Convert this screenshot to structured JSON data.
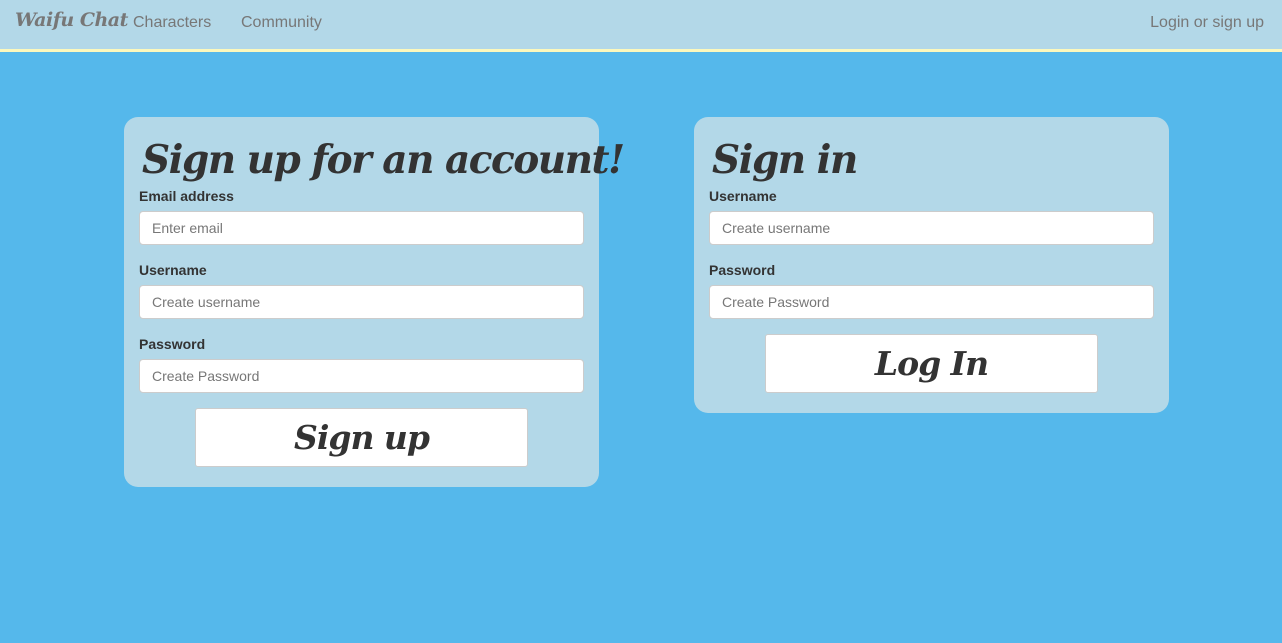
{
  "navbar": {
    "brand": "Waifu Chat",
    "links": [
      "Characters",
      "Community"
    ],
    "login": "Login or sign up"
  },
  "signup": {
    "title": "Sign up for an account!",
    "email_label": "Email address",
    "email_placeholder": "Enter email",
    "username_label": "Username",
    "username_placeholder": "Create username",
    "password_label": "Password",
    "password_placeholder": "Create Password",
    "button": "Sign up"
  },
  "signin": {
    "title": "Sign in",
    "username_label": "Username",
    "username_placeholder": "Create username",
    "password_label": "Password",
    "password_placeholder": "Create Password",
    "button": "Log In"
  },
  "colors": {
    "page_background": "#55b8eb",
    "panel_background": "#b3d8e8",
    "navbar_border": "#fbf8bd"
  }
}
